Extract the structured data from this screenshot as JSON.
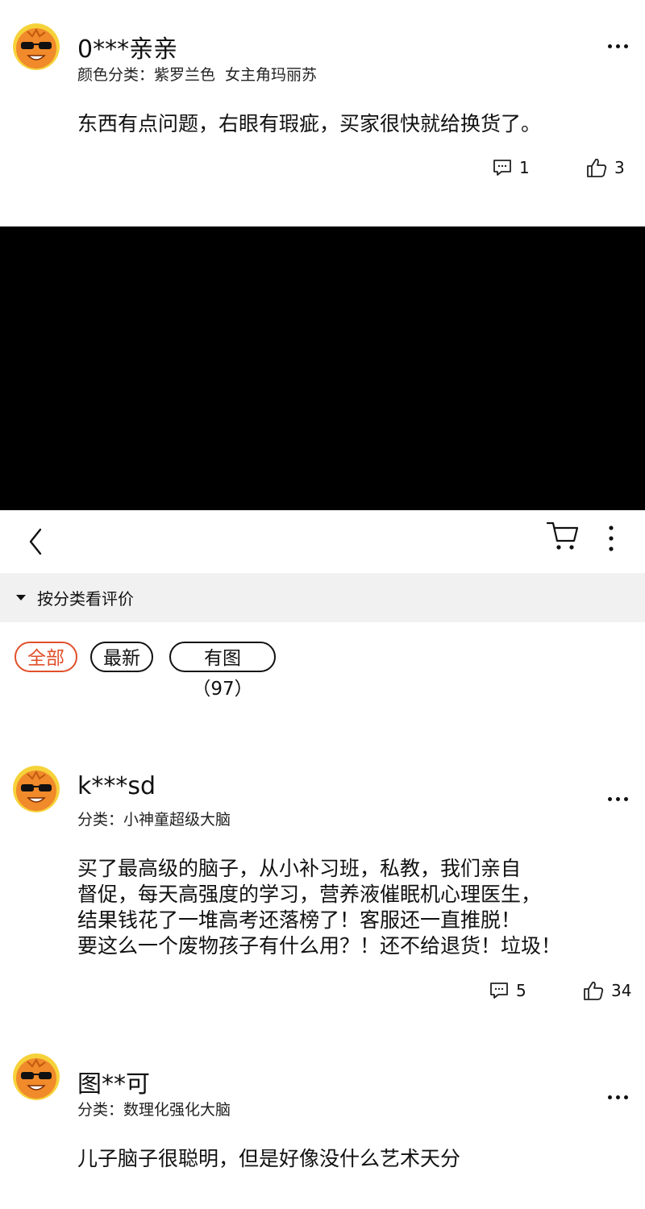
{
  "reviews": [
    {
      "username": "0***亲亲",
      "category": [
        "颜色分类：紫罗兰色",
        "女主角玛丽苏"
      ],
      "text": "东西有点问题，右眼有瑕疵，买家很快就给换货了。",
      "comments": "1",
      "likes": "3"
    },
    {
      "username": "k***sd",
      "category": [
        "分类：小神童超级大脑"
      ],
      "text_lines": [
        "买了最高级的脑子，从小补习班，私教，我们亲自",
        "督促，每天高强度的学习，营养液催眠机心理医生，",
        "结果钱花了一堆高考还落榜了！客服还一直推脱！",
        "要这么一个废物孩子有什么用？！还不给退货！垃圾！"
      ],
      "comments": "5",
      "likes": "34"
    },
    {
      "username": "图**可",
      "category": [
        "分类：数理化强化大脑"
      ],
      "text": "儿子脑子很聪明，但是好像没什么艺术天分"
    }
  ],
  "filter": {
    "label": "按分类看评价"
  },
  "tabs": [
    {
      "label": "全部",
      "active": true
    },
    {
      "label": "最新",
      "active": false
    },
    {
      "label": "有图（97）",
      "active": false
    }
  ],
  "icons": {
    "back": "chevron-left-icon",
    "cart": "cart-icon",
    "menu": "vertical-dots-icon",
    "more": "horizontal-dots-icon",
    "comment": "comment-icon",
    "like": "thumbs-up-icon"
  },
  "colors": {
    "accent": "#e0502a",
    "filter_bg": "#f1f1f1",
    "avatar": "#f08a2a"
  }
}
